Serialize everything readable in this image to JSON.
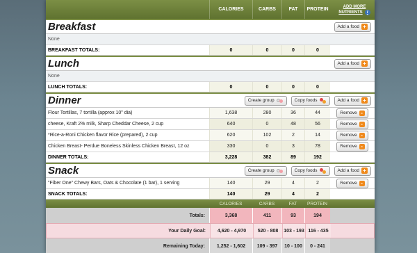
{
  "columns": {
    "calories": "CALORIES",
    "carbs": "CARBS",
    "fat": "FAT",
    "protein": "PROTEIN",
    "add_more_line1": "ADD MORE",
    "add_more_line2": "NUTRIENTS"
  },
  "buttons": {
    "add_food": "Add a food",
    "create_group": "Create group",
    "copy_foods": "Copy foods",
    "remove": "Remove"
  },
  "breakfast": {
    "title": "Breakfast",
    "none": "None",
    "totals_label": "BREAKFAST TOTALS:",
    "totals": [
      "0",
      "0",
      "0",
      "0"
    ]
  },
  "lunch": {
    "title": "Lunch",
    "none": "None",
    "totals_label": "LUNCH TOTALS:",
    "totals": [
      "0",
      "0",
      "0",
      "0"
    ]
  },
  "dinner": {
    "title": "Dinner",
    "items": [
      {
        "name": "Flour Tortillas, 7 tortilla (approx 10\" dia)",
        "calories": "1,638",
        "carbs": "280",
        "fat": "36",
        "protein": "44"
      },
      {
        "name": "cheese, Kraft 2% milk, Sharp Cheddar Cheese, 2 cup",
        "calories": "640",
        "carbs": "0",
        "fat": "48",
        "protein": "56"
      },
      {
        "name": "*Rice-a-Roni Chicken flavor Rice (prepared), 2 cup",
        "calories": "620",
        "carbs": "102",
        "fat": "2",
        "protein": "14"
      },
      {
        "name": "Chicken Breast- Perdue Boneless Skinless Chicken Breast, 12 oz",
        "calories": "330",
        "carbs": "0",
        "fat": "3",
        "protein": "78"
      }
    ],
    "totals_label": "DINNER TOTALS:",
    "totals": [
      "3,228",
      "382",
      "89",
      "192"
    ]
  },
  "snack": {
    "title": "Snack",
    "items": [
      {
        "name": "\"Fiber One\" Chewy Bars, Oats & Chocolate (1 bar), 1 serving",
        "calories": "140",
        "carbs": "29",
        "fat": "4",
        "protein": "2"
      }
    ],
    "totals_label": "SNACK TOTALS:",
    "totals": [
      "140",
      "29",
      "4",
      "2"
    ]
  },
  "summary": {
    "headers": [
      "CALORIES",
      "CARBS",
      "FAT",
      "PROTEIN"
    ],
    "totals_label": "Totals:",
    "totals": [
      "3,368",
      "411",
      "93",
      "194"
    ],
    "goal_label": "Your Daily Goal:",
    "goal": [
      "4,620 - 4,970",
      "520 - 808",
      "103 - 193",
      "116 - 435"
    ],
    "remaining_label": "Remaining Today:",
    "remaining": [
      "1,252 - 1,602",
      "109 - 397",
      "10 - 100",
      "0 - 241"
    ]
  }
}
